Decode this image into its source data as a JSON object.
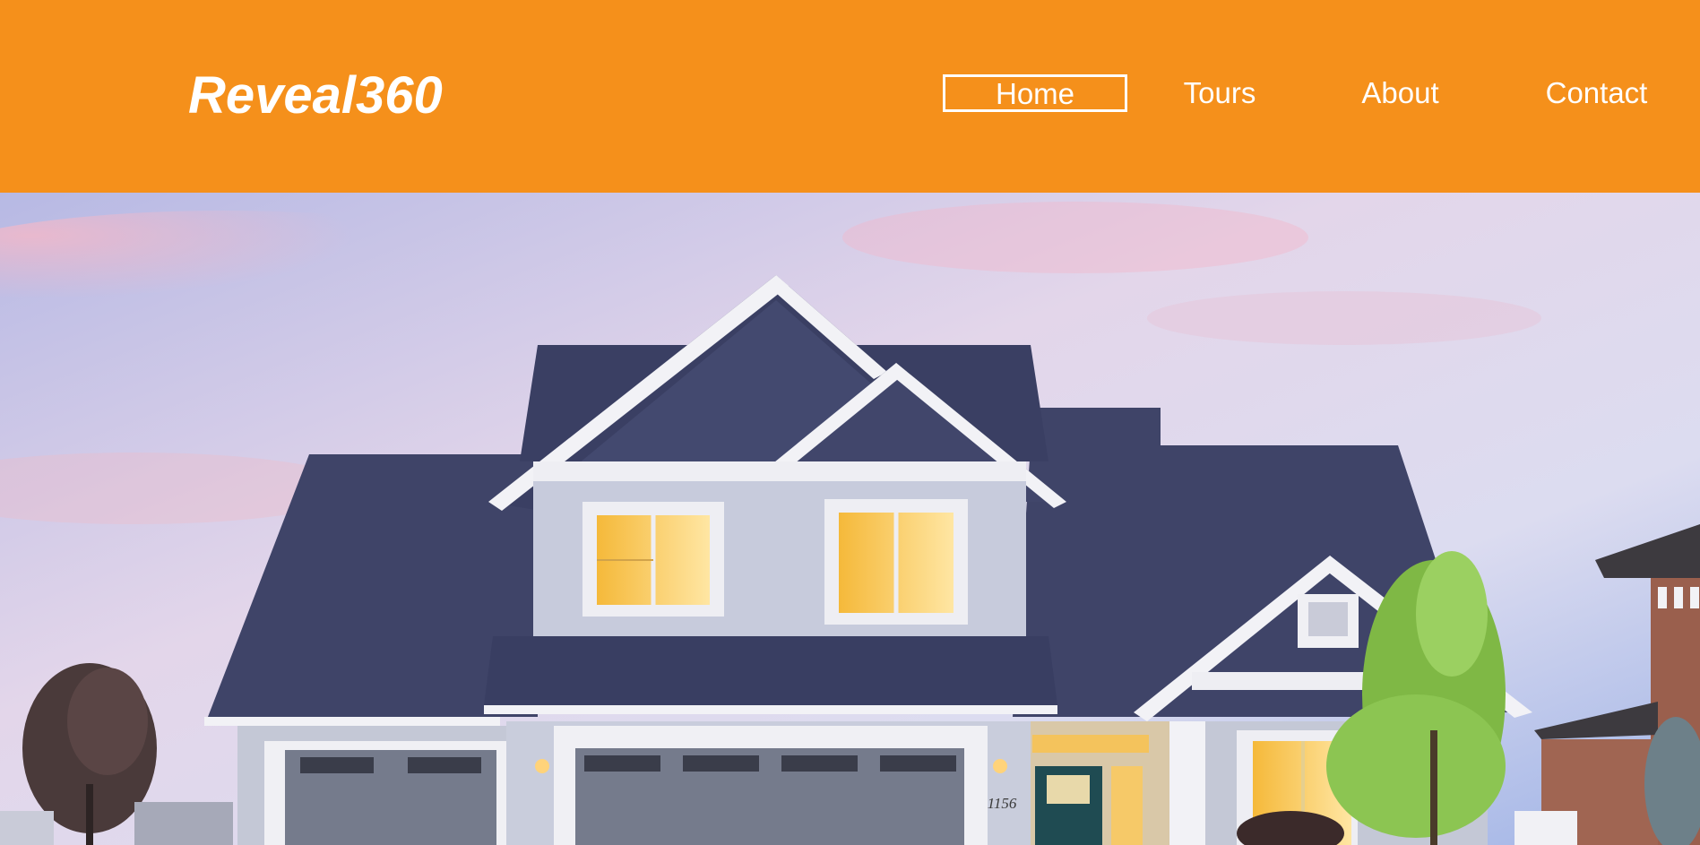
{
  "header": {
    "logo": "Reveal360",
    "nav": {
      "home": "Home",
      "tours": "Tours",
      "about": "About",
      "contact": "Contact"
    },
    "background_color": "#f5901b",
    "active_item": "Home"
  },
  "hero": {
    "house_number": "1156"
  }
}
